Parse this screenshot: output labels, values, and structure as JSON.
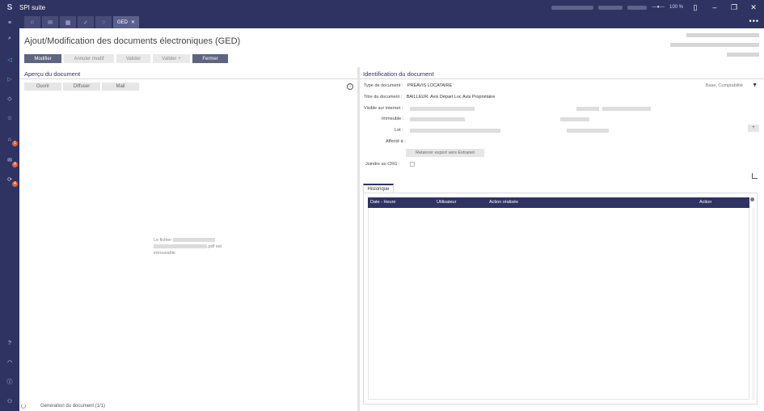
{
  "app": {
    "title": "SPI suite"
  },
  "titlebar": {
    "zoom": "100 %"
  },
  "tabs": {
    "active_label": "GED"
  },
  "page": {
    "title": "Ajout/Modification des documents électroniques (GED)"
  },
  "toolbar": {
    "modifier": "Modifier",
    "annuler": "Annuler modif",
    "valider": "Valider",
    "valider_plus": "Valider +",
    "fermer": "Fermer"
  },
  "preview": {
    "title": "Aperçu du document",
    "ouvrir": "Ouvrir",
    "diffuser": "Diffuser",
    "mail": "Mail",
    "notfound_prefix": "Le fichier",
    "notfound_suffix": ".pdf est",
    "notfound_end": "introuvable"
  },
  "status": {
    "text": "Génération du document (1/1)"
  },
  "ident": {
    "title": "Identification du document",
    "type_label": "Type de document :",
    "type_value": "PREAVIS LOCATAIRE",
    "titre_label": "Titre du document :",
    "titre_value": "BAILLEUR: Avis Départ Loc Avis Propriétaire",
    "visible_label": "Visible sur internet :",
    "immeuble_label": "Immeuble :",
    "lot_label": "Lot :",
    "affecte_label": "Affecté à :",
    "relancer": "Relancer export vers Extranet",
    "joindre_label": "Joindre au CRG :",
    "base_link": "Base, Comptabilité",
    "plus": "+"
  },
  "history": {
    "tab": "Historique",
    "columns": [
      "Date - Heure",
      "Utilisateur",
      "Action réalisée",
      "Action"
    ]
  }
}
